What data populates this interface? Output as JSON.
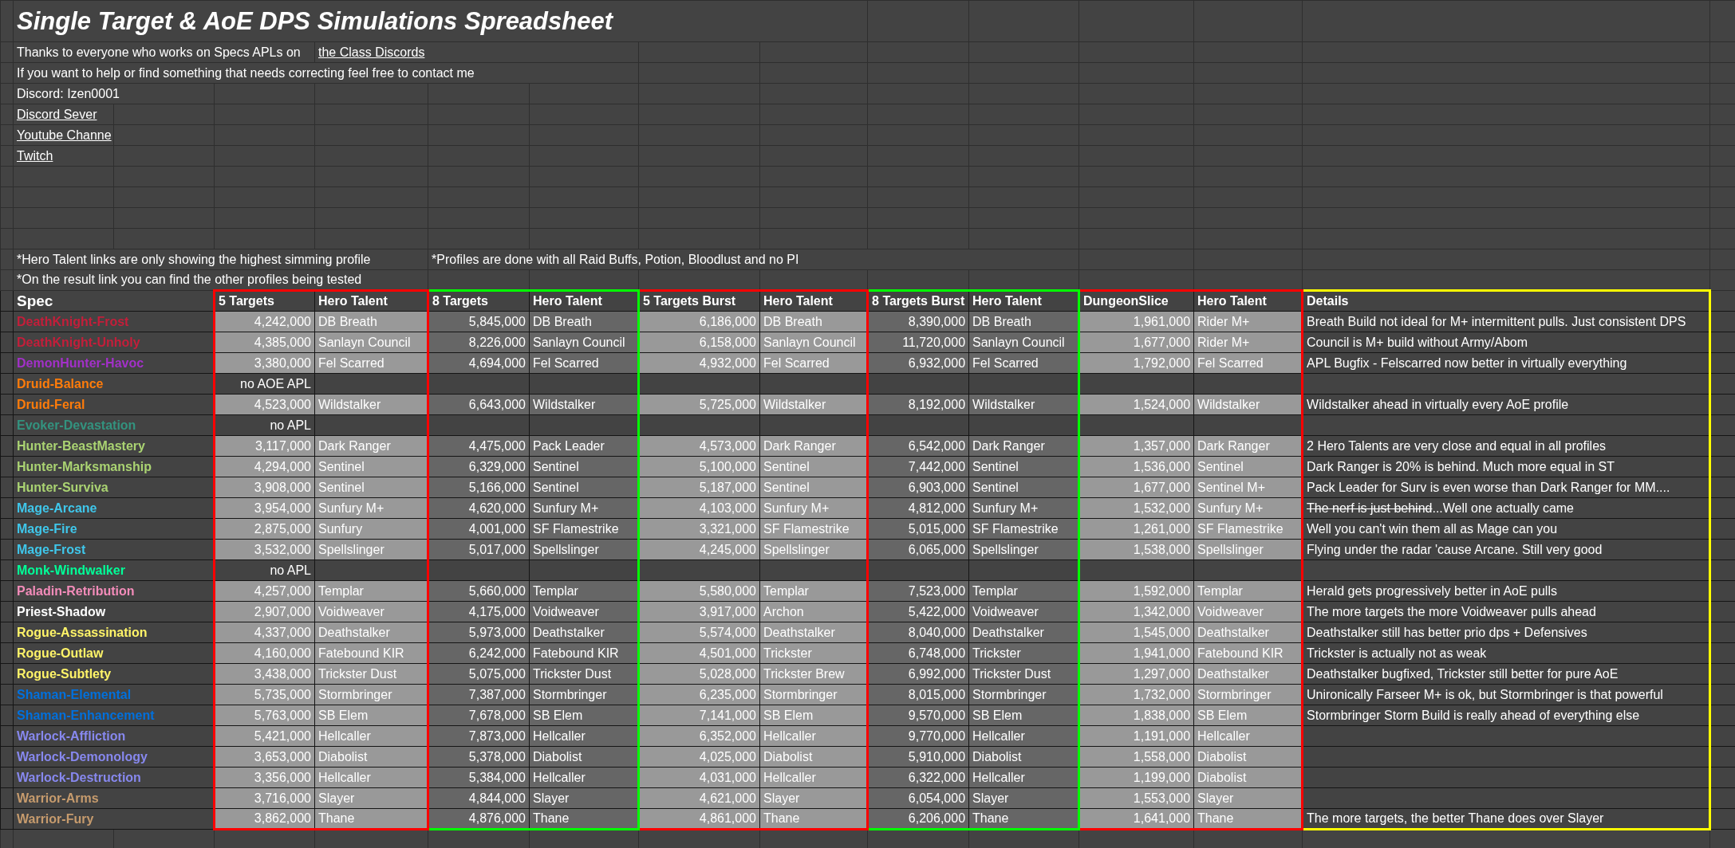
{
  "title": "Single Target & AoE DPS Simulations Spreadsheet",
  "thanks": {
    "text": "Thanks to everyone who works on Specs APLs on",
    "link": "the Class Discords"
  },
  "contact": "If you want to help or find something that needs correcting feel free to contact me",
  "discord": "Discord: Izen0001",
  "links": [
    "Discord Sever",
    "Youtube Channe",
    "Twitch"
  ],
  "notes": [
    "*Hero Talent links are only showing the highest simming profile",
    "*Profiles are done with all Raid Buffs, Potion, Bloodlust and no PI",
    "*On the result link you can find the other profiles being tested"
  ],
  "table": {
    "spec_header": "Spec",
    "groups": [
      {
        "color": "#ff0000",
        "kind": "light",
        "columns": [
          {
            "label": "5 Targets",
            "kind": "number"
          },
          {
            "label": "Hero Talent",
            "kind": "text"
          }
        ]
      },
      {
        "color": "#00ff00",
        "kind": "dark",
        "columns": [
          {
            "label": "8 Targets",
            "kind": "number"
          },
          {
            "label": "Hero Talent",
            "kind": "text"
          }
        ]
      },
      {
        "color": "#ff0000",
        "kind": "light",
        "columns": [
          {
            "label": "5 Targets Burst",
            "kind": "number"
          },
          {
            "label": "Hero Talent",
            "kind": "text"
          }
        ]
      },
      {
        "color": "#00ff00",
        "kind": "dark",
        "columns": [
          {
            "label": "8 Targets Burst",
            "kind": "number"
          },
          {
            "label": "Hero Talent",
            "kind": "text"
          }
        ]
      },
      {
        "color": "#ff0000",
        "kind": "light",
        "columns": [
          {
            "label": "DungeonSlice",
            "kind": "number"
          },
          {
            "label": "Hero Talent",
            "kind": "text"
          }
        ]
      }
    ],
    "details": {
      "label": "Details",
      "color": "#ffff00"
    },
    "rows": [
      {
        "spec": "DeathKnight-Frost",
        "color": "#c41e3a",
        "kind": "sim",
        "values": [
          "4,242,000",
          "DB Breath",
          "5,845,000",
          "DB Breath",
          "6,186,000",
          "DB Breath",
          "8,390,000",
          "DB Breath",
          "1,961,000",
          "Rider M+"
        ],
        "details": "Breath Build not ideal for M+ intermittent pulls. Just consistent DPS"
      },
      {
        "spec": "DeathKnight-Unholy",
        "color": "#c41e3a",
        "kind": "sim",
        "values": [
          "4,385,000",
          "Sanlayn Council",
          "8,226,000",
          "Sanlayn Council",
          "6,158,000",
          "Sanlayn Council",
          "11,720,000",
          "Sanlayn Council",
          "1,677,000",
          "Rider M+"
        ],
        "details": "Council is M+ build without Army/Abom"
      },
      {
        "spec": "DemonHunter-Havoc",
        "color": "#a330c9",
        "kind": "sim",
        "values": [
          "3,380,000",
          "Fel Scarred",
          "4,694,000",
          "Fel Scarred",
          "4,932,000",
          "Fel Scarred",
          "6,932,000",
          "Fel Scarred",
          "1,792,000",
          "Fel Scarred"
        ],
        "details": "APL Bugfix - Felscarred now better in virtually everything"
      },
      {
        "spec": "Druid-Balance",
        "color": "#ff7c0a",
        "kind": "no_apl",
        "note": "no AOE APL"
      },
      {
        "spec": "Druid-Feral",
        "color": "#ff7c0a",
        "kind": "sim",
        "values": [
          "4,523,000",
          "Wildstalker",
          "6,643,000",
          "Wildstalker",
          "5,725,000",
          "Wildstalker",
          "8,192,000",
          "Wildstalker",
          "1,524,000",
          "Wildstalker"
        ],
        "details": "Wildstalker ahead in virtually every AoE profile"
      },
      {
        "spec": "Evoker-Devastation",
        "color": "#33937f",
        "kind": "no_apl",
        "note": "no APL"
      },
      {
        "spec": "Hunter-BeastMastery",
        "color": "#aad372",
        "kind": "sim",
        "values": [
          "3,117,000",
          "Dark Ranger",
          "4,475,000",
          "Pack Leader",
          "4,573,000",
          "Dark Ranger",
          "6,542,000",
          "Dark Ranger",
          "1,357,000",
          "Dark Ranger"
        ],
        "details": "2 Hero Talents are very close and equal in all profiles"
      },
      {
        "spec": "Hunter-Marksmanship",
        "color": "#aad372",
        "kind": "sim",
        "values": [
          "4,294,000",
          "Sentinel",
          "6,329,000",
          "Sentinel",
          "5,100,000",
          "Sentinel",
          "7,442,000",
          "Sentinel",
          "1,536,000",
          "Sentinel"
        ],
        "details": "Dark Ranger is 20% is behind. Much more equal in ST"
      },
      {
        "spec": "Hunter-Surviva",
        "color": "#aad372",
        "kind": "sim",
        "values": [
          "3,908,000",
          "Sentinel",
          "5,166,000",
          "Sentinel",
          "5,187,000",
          "Sentinel",
          "6,903,000",
          "Sentinel",
          "1,677,000",
          "Sentinel M+"
        ],
        "details": "Pack Leader for Surv is even worse than Dark Ranger for MM...."
      },
      {
        "spec": "Mage-Arcane",
        "color": "#3fc7eb",
        "kind": "sim",
        "values": [
          "3,954,000",
          "Sunfury M+",
          "4,620,000",
          "Sunfury M+",
          "4,103,000",
          "Sunfury M+",
          "4,812,000",
          "Sunfury M+",
          "1,532,000",
          "Sunfury M+"
        ],
        "details_struck": "The nerf is just behind",
        "details": "...Well one actually came"
      },
      {
        "spec": "Mage-Fire",
        "color": "#3fc7eb",
        "kind": "sim",
        "values": [
          "2,875,000",
          "Sunfury",
          "4,001,000",
          "SF Flamestrike",
          "3,321,000",
          "SF Flamestrike",
          "5,015,000",
          "SF Flamestrike",
          "1,261,000",
          "SF Flamestrike"
        ],
        "details": "Well you can't win them all as Mage can you"
      },
      {
        "spec": "Mage-Frost",
        "color": "#3fc7eb",
        "kind": "sim",
        "values": [
          "3,532,000",
          "Spellslinger",
          "5,017,000",
          "Spellslinger",
          "4,245,000",
          "Spellslinger",
          "6,065,000",
          "Spellslinger",
          "1,538,000",
          "Spellslinger"
        ],
        "details": "Flying under the radar 'cause Arcane. Still very good"
      },
      {
        "spec": "Monk-Windwalker",
        "color": "#00ff98",
        "kind": "no_apl",
        "note": "no APL"
      },
      {
        "spec": "Paladin-Retribution",
        "color": "#f48cba",
        "kind": "sim",
        "values": [
          "4,257,000",
          "Templar",
          "5,660,000",
          "Templar",
          "5,580,000",
          "Templar",
          "7,523,000",
          "Templar",
          "1,592,000",
          "Templar"
        ],
        "details": "Herald gets progressively better in AoE pulls"
      },
      {
        "spec": "Priest-Shadow",
        "color": "#ffffff",
        "kind": "sim",
        "values": [
          "2,907,000",
          "Voidweaver",
          "4,175,000",
          "Voidweaver",
          "3,917,000",
          "Archon",
          "5,422,000",
          "Voidweaver",
          "1,342,000",
          "Voidweaver"
        ],
        "details": "The more targets the more Voidweaver pulls ahead"
      },
      {
        "spec": "Rogue-Assassination",
        "color": "#fff468",
        "kind": "sim",
        "values": [
          "4,337,000",
          "Deathstalker",
          "5,973,000",
          "Deathstalker",
          "5,574,000",
          "Deathstalker",
          "8,040,000",
          "Deathstalker",
          "1,545,000",
          "Deathstalker"
        ],
        "details": "Deathstalker still has better prio dps + Defensives"
      },
      {
        "spec": "Rogue-Outlaw",
        "color": "#fff468",
        "kind": "sim",
        "values": [
          "4,160,000",
          "Fatebound KIR",
          "6,242,000",
          "Fatebound KIR",
          "4,501,000",
          "Trickster",
          "6,748,000",
          "Trickster",
          "1,941,000",
          "Fatebound KIR"
        ],
        "details": "Trickster is actually not as weak"
      },
      {
        "spec": "Rogue-Subtlety",
        "color": "#fff468",
        "kind": "sim",
        "values": [
          "3,438,000",
          "Trickster Dust",
          "5,075,000",
          "Trickster Dust",
          "5,028,000",
          "Trickster Brew",
          "6,992,000",
          "Trickster Dust",
          "1,297,000",
          "Deathstalker"
        ],
        "details": "Deathstalker bugfixed, Trickster still better for pure AoE"
      },
      {
        "spec": "Shaman-Elemental",
        "color": "#0070dd",
        "kind": "sim",
        "values": [
          "5,735,000",
          "Stormbringer",
          "7,387,000",
          "Stormbringer",
          "6,235,000",
          "Stormbringer",
          "8,015,000",
          "Stormbringer",
          "1,732,000",
          "Stormbringer"
        ],
        "details": "Unironically Farseer M+ is ok, but Stormbringer is that powerful"
      },
      {
        "spec": "Shaman-Enhancement",
        "color": "#0070dd",
        "kind": "sim",
        "values": [
          "5,763,000",
          "SB Elem",
          "7,678,000",
          "SB Elem",
          "7,141,000",
          "SB Elem",
          "9,570,000",
          "SB Elem",
          "1,838,000",
          "SB Elem"
        ],
        "details": "Stormbringer Storm Build is really ahead of everything else"
      },
      {
        "spec": "Warlock-Affliction",
        "color": "#8788ee",
        "kind": "sim",
        "values": [
          "5,421,000",
          "Hellcaller",
          "7,873,000",
          "Hellcaller",
          "6,352,000",
          "Hellcaller",
          "9,770,000",
          "Hellcaller",
          "1,191,000",
          "Hellcaller"
        ]
      },
      {
        "spec": "Warlock-Demonology",
        "color": "#8788ee",
        "kind": "sim",
        "values": [
          "3,653,000",
          "Diabolist",
          "5,378,000",
          "Diabolist",
          "4,025,000",
          "Diabolist",
          "5,910,000",
          "Diabolist",
          "1,558,000",
          "Diabolist"
        ]
      },
      {
        "spec": "Warlock-Destruction",
        "color": "#8788ee",
        "kind": "sim",
        "values": [
          "3,356,000",
          "Hellcaller",
          "5,384,000",
          "Hellcaller",
          "4,031,000",
          "Hellcaller",
          "6,322,000",
          "Hellcaller",
          "1,199,000",
          "Diabolist"
        ]
      },
      {
        "spec": "Warrior-Arms",
        "color": "#c69b6d",
        "kind": "sim",
        "values": [
          "3,716,000",
          "Slayer",
          "4,844,000",
          "Slayer",
          "4,621,000",
          "Slayer",
          "6,054,000",
          "Slayer",
          "1,553,000",
          "Slayer"
        ]
      },
      {
        "spec": "Warrior-Fury",
        "color": "#c69b6d",
        "kind": "sim",
        "values": [
          "3,862,000",
          "Thane",
          "4,876,000",
          "Thane",
          "4,861,000",
          "Thane",
          "6,206,000",
          "Thane",
          "1,641,000",
          "Thane"
        ],
        "details": "The more targets, the better Thane does over Slayer"
      }
    ]
  }
}
